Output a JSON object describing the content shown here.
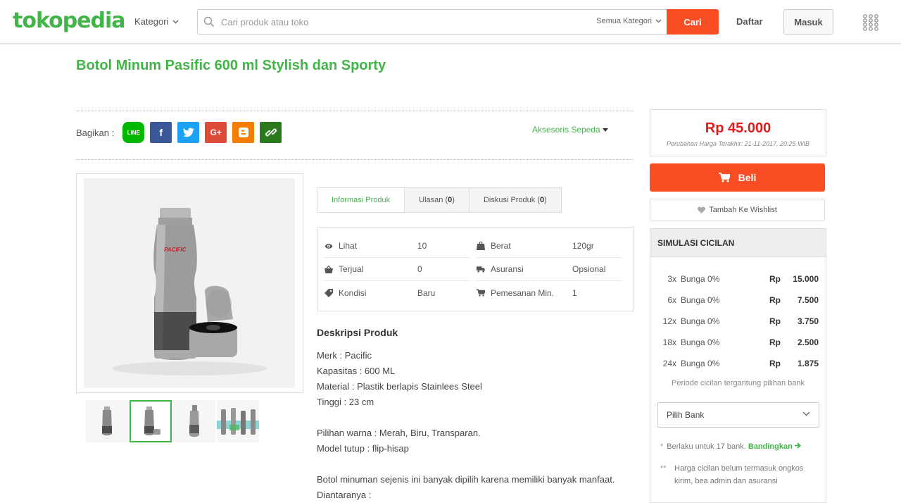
{
  "header": {
    "logo": "tokopedia",
    "kategori_label": "Kategori",
    "search_placeholder": "Cari produk atau toko",
    "semua_kategori": "Semua Kategori",
    "cari_label": "Cari",
    "daftar_label": "Daftar",
    "masuk_label": "Masuk"
  },
  "product": {
    "title": "Botol Minum Pasific 600 ml Stylish dan Sporty",
    "share_label": "Bagikan :",
    "category": "Aksesoris Sepeda"
  },
  "tabs": [
    {
      "label": "Informasi Produk",
      "count": ""
    },
    {
      "label": "Ulasan",
      "count": "0"
    },
    {
      "label": "Diskusi Produk",
      "count": "0"
    }
  ],
  "info": {
    "left": [
      {
        "icon": "eye-icon",
        "label": "Lihat",
        "value": "10"
      },
      {
        "icon": "basket-icon",
        "label": "Terjual",
        "value": "0"
      },
      {
        "icon": "tag-icon",
        "label": "Kondisi",
        "value": "Baru"
      }
    ],
    "right": [
      {
        "icon": "weight-icon",
        "label": "Berat",
        "value": "120gr"
      },
      {
        "icon": "truck-icon",
        "label": "Asuransi",
        "value": "Opsional"
      },
      {
        "icon": "cart-icon",
        "label": "Pemesanan Min.",
        "value": "1"
      }
    ]
  },
  "description": {
    "title": "Deskripsi Produk",
    "lines": [
      "Merk : Pacific",
      "Kapasitas : 600 ML",
      "Material : Plastik berlapis Stainlees Steel",
      "Tinggi : 23 cm",
      "",
      "Pilihan warna : Merah, Biru, Transparan.",
      "Model tutup : flip-hisap",
      "",
      "Botol minuman sejenis ini banyak dipilih karena memiliki banyak manfaat.",
      "Diantaranya :"
    ]
  },
  "pricing": {
    "price": "Rp 45.000",
    "price_note": "Perubahan Harga Terakhir: 21-11-2017, 20:25 WIB",
    "beli_label": "Beli",
    "wishlist_label": "Tambah Ke Wishlist"
  },
  "cicilan": {
    "title": "SIMULASI CICILAN",
    "rows": [
      {
        "tenor": "3x",
        "bunga": "Bunga 0%",
        "currency": "Rp",
        "amount": "15.000"
      },
      {
        "tenor": "6x",
        "bunga": "Bunga 0%",
        "currency": "Rp",
        "amount": "7.500"
      },
      {
        "tenor": "12x",
        "bunga": "Bunga 0%",
        "currency": "Rp",
        "amount": "3.750"
      },
      {
        "tenor": "18x",
        "bunga": "Bunga 0%",
        "currency": "Rp",
        "amount": "2.500"
      },
      {
        "tenor": "24x",
        "bunga": "Bunga 0%",
        "currency": "Rp",
        "amount": "1.875"
      }
    ],
    "note": "Periode cicilan tergantung pilihan bank",
    "bank_select": "Pilih Bank",
    "footnote1": "Berlaku untuk 17 bank.",
    "footnote1_link": "Bandingkan",
    "footnote2": "Harga cicilan belum termasuk ongkos kirim, bea admin dan asuransi"
  },
  "colors": {
    "brand_green": "#42b549",
    "accent_orange": "#f94d24",
    "price_red": "#e51b1b"
  }
}
